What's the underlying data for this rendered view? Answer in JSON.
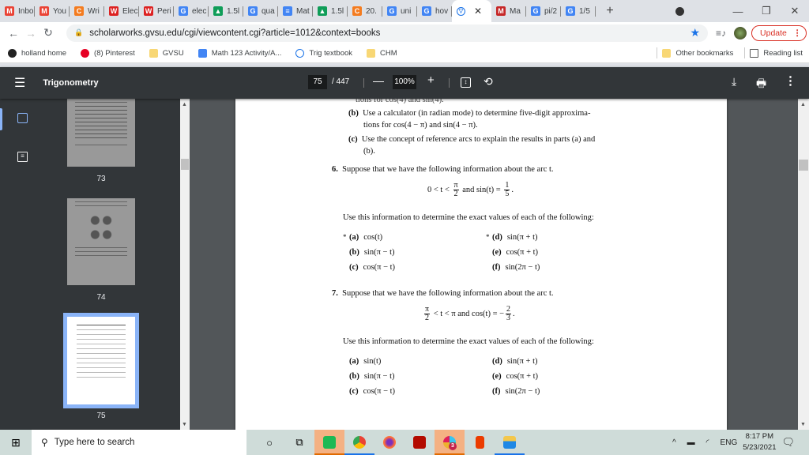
{
  "browser": {
    "tabs": [
      {
        "icon": "gmail-icon",
        "label": "Inbo",
        "color": "#ea4335",
        "glyph": "M"
      },
      {
        "icon": "gmail-icon",
        "label": "You",
        "color": "#ea4335",
        "glyph": "M"
      },
      {
        "icon": "c-icon",
        "label": "Wri",
        "color": "#f47c20",
        "glyph": "C"
      },
      {
        "icon": "wolfram-icon",
        "label": "Elec",
        "color": "#d22",
        "glyph": "W"
      },
      {
        "icon": "wolfram-icon",
        "label": "Peri",
        "color": "#d22",
        "glyph": "W"
      },
      {
        "icon": "google-icon",
        "label": "elec",
        "color": "#4285f4",
        "glyph": "G"
      },
      {
        "icon": "drive-icon",
        "label": "1.5l",
        "color": "#0f9d58",
        "glyph": "▲"
      },
      {
        "icon": "google-icon",
        "label": "qua",
        "color": "#4285f4",
        "glyph": "G"
      },
      {
        "icon": "docs-icon",
        "label": "Mat",
        "color": "#4285f4",
        "glyph": "≡"
      },
      {
        "icon": "drive-icon",
        "label": "1.5l",
        "color": "#0f9d58",
        "glyph": "▲"
      },
      {
        "icon": "c-icon",
        "label": "20.",
        "color": "#f47c20",
        "glyph": "C"
      },
      {
        "icon": "google-icon",
        "label": "uni",
        "color": "#4285f4",
        "glyph": "G"
      },
      {
        "icon": "google-icon",
        "label": "hov",
        "color": "#4285f4",
        "glyph": "G"
      }
    ],
    "active_tab": {
      "icon": "scholarworks-icon",
      "close": "✕"
    },
    "tabs_after": [
      {
        "icon": "mathway-icon",
        "label": "Ma",
        "color": "#c62828",
        "glyph": "M"
      },
      {
        "icon": "google-icon",
        "label": "pi/2",
        "color": "#4285f4",
        "glyph": "G"
      },
      {
        "icon": "google-icon",
        "label": "1/5",
        "color": "#4285f4",
        "glyph": "G"
      }
    ],
    "new_tab": "+",
    "window": {
      "minimize": "—",
      "restore": "❐",
      "close": "✕"
    },
    "url": "scholarworks.gvsu.edu/cgi/viewcontent.cgi?article=1012&context=books",
    "update_label": "Update",
    "bookmarks": [
      {
        "label": "holland home",
        "icon": "site-icon"
      },
      {
        "label": "(8) Pinterest",
        "icon": "pinterest-icon"
      },
      {
        "label": "GVSU",
        "icon": "folder-icon"
      },
      {
        "label": "Math 123 Activity/A...",
        "icon": "docs-icon"
      },
      {
        "label": "Trig textbook",
        "icon": "scholarworks-icon"
      },
      {
        "label": "CHM",
        "icon": "folder-icon"
      }
    ],
    "other_bookmarks": "Other bookmarks",
    "reading_list": "Reading list"
  },
  "pdf": {
    "title": "Trigonometry",
    "current_page": "75",
    "total_pages": "/ 447",
    "zoom": "100%",
    "thumbnail_labels": [
      "73",
      "74",
      "75"
    ],
    "content": {
      "cut_top": "tions for cos(4) and sin(4).",
      "q5b_1": "Use a calculator (in radian mode) to determine five-digit approxima-",
      "q5b_2": "tions for cos(4 − π) and sin(4 − π).",
      "q5c_1": "Use the concept of reference arcs to explain the results in parts (a) and",
      "q5c_2": "(b).",
      "q6": {
        "num": "6.",
        "text": "Suppose that we have the following information about the arc t.",
        "cond_left": "0 < t <",
        "cond_frac": [
          "π",
          "2"
        ],
        "cond_mid": "and  sin(t) =",
        "cond_frac2": [
          "1",
          "5"
        ],
        "instruction": "Use this information to determine the exact values of each of the following:",
        "parts": [
          {
            "star": "*",
            "label": "(a)",
            "expr": "cos(t)"
          },
          {
            "star": "",
            "label": "(b)",
            "expr": "sin(π − t)"
          },
          {
            "star": "",
            "label": "(c)",
            "expr": "cos(π − t)"
          },
          {
            "star": "*",
            "label": "(d)",
            "expr": "sin(π + t)"
          },
          {
            "star": "",
            "label": "(e)",
            "expr": "cos(π + t)"
          },
          {
            "star": "",
            "label": "(f)",
            "expr": "sin(2π − t)"
          }
        ]
      },
      "q7": {
        "num": "7.",
        "text": "Suppose that we have the following information about the arc t.",
        "cond_frac": [
          "π",
          "2"
        ],
        "cond_mid": "< t < π  and  cos(t) = −",
        "cond_frac2": [
          "2",
          "3"
        ],
        "instruction": "Use this information to determine the exact values of each of the following:",
        "parts": [
          {
            "label": "(a)",
            "expr": "sin(t)"
          },
          {
            "label": "(b)",
            "expr": "sin(π − t)"
          },
          {
            "label": "(c)",
            "expr": "cos(π − t)"
          },
          {
            "label": "(d)",
            "expr": "sin(π + t)"
          },
          {
            "label": "(e)",
            "expr": "cos(π + t)"
          },
          {
            "label": "(f)",
            "expr": "sin(2π − t)"
          }
        ]
      }
    }
  },
  "taskbar": {
    "search_placeholder": "Type here to search",
    "tray_lang": "ENG",
    "time": "8:17 PM",
    "date": "5/23/2021",
    "slack_badge": "3"
  }
}
